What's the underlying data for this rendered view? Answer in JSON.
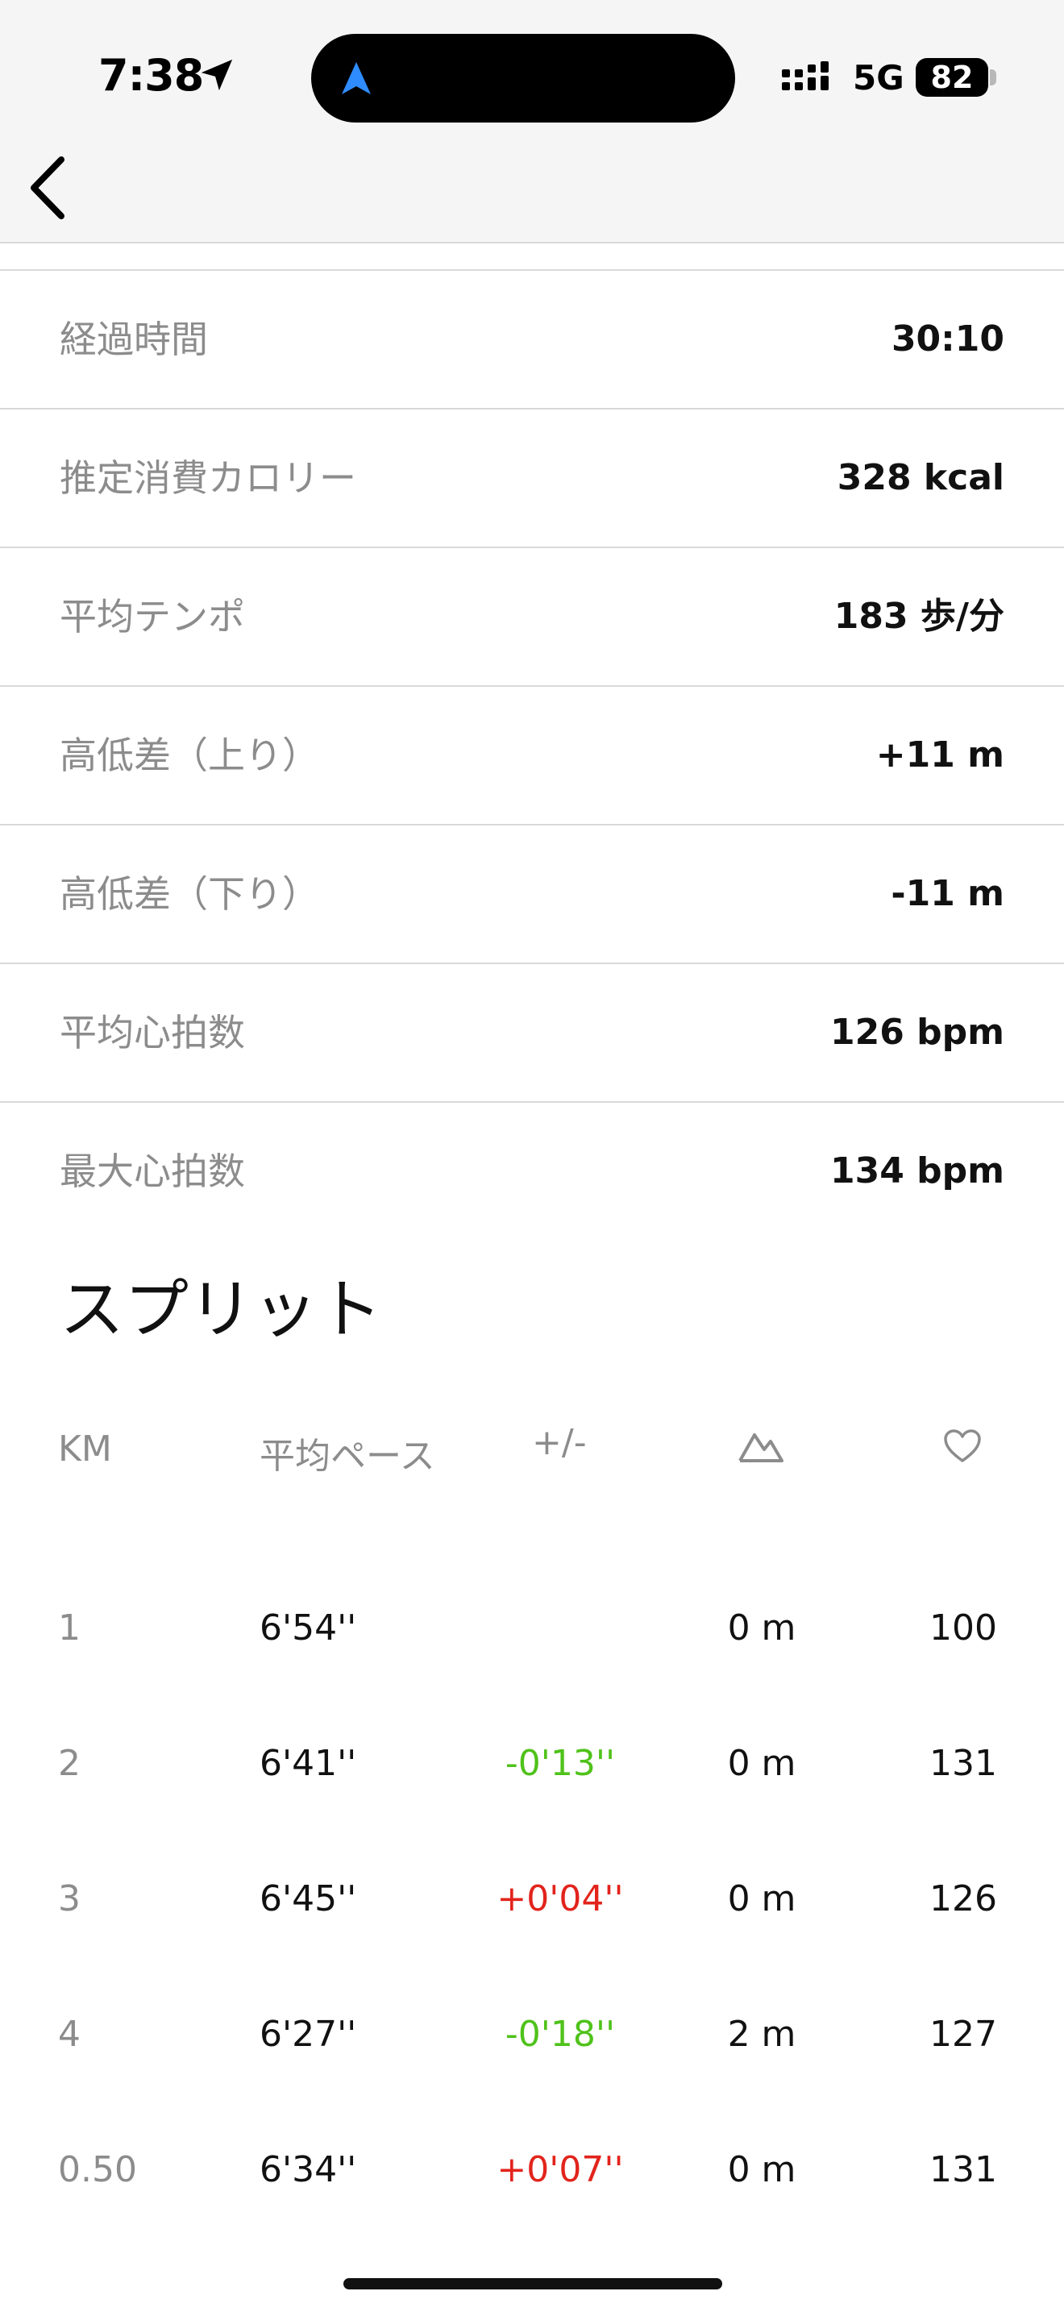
{
  "status_bar": {
    "time": "7:38",
    "network": "5G",
    "battery": "82"
  },
  "stats": [
    {
      "label": "経過時間",
      "value": "30:10"
    },
    {
      "label": "推定消費カロリー",
      "value": "328 kcal"
    },
    {
      "label": "平均テンポ",
      "value": "183 歩/分"
    },
    {
      "label": "高低差（上り）",
      "value": "+11 m"
    },
    {
      "label": "高低差（下り）",
      "value": "-11 m"
    },
    {
      "label": "平均心拍数",
      "value": "126 bpm"
    },
    {
      "label": "最大心拍数",
      "value": "134 bpm"
    }
  ],
  "splits": {
    "title": "スプリット",
    "headers": {
      "km": "KM",
      "pace": "平均ペース",
      "diff": "+/-",
      "elevation_icon": "mountain-icon",
      "heart_icon": "heart-icon"
    },
    "rows": [
      {
        "km": "1",
        "pace": "6'54''",
        "diff": "",
        "diff_color": "",
        "elev": "0 m",
        "hr": "100"
      },
      {
        "km": "2",
        "pace": "6'41''",
        "diff": "-0'13''",
        "diff_color": "#4fc21a",
        "elev": "0 m",
        "hr": "131"
      },
      {
        "km": "3",
        "pace": "6'45''",
        "diff": "+0'04''",
        "diff_color": "#e2241c",
        "elev": "0 m",
        "hr": "126"
      },
      {
        "km": "4",
        "pace": "6'27''",
        "diff": "-0'18''",
        "diff_color": "#4fc21a",
        "elev": "2 m",
        "hr": "127"
      },
      {
        "km": "0.50",
        "pace": "6'34''",
        "diff": "+0'07''",
        "diff_color": "#e2241c",
        "elev": "0 m",
        "hr": "131"
      }
    ]
  }
}
